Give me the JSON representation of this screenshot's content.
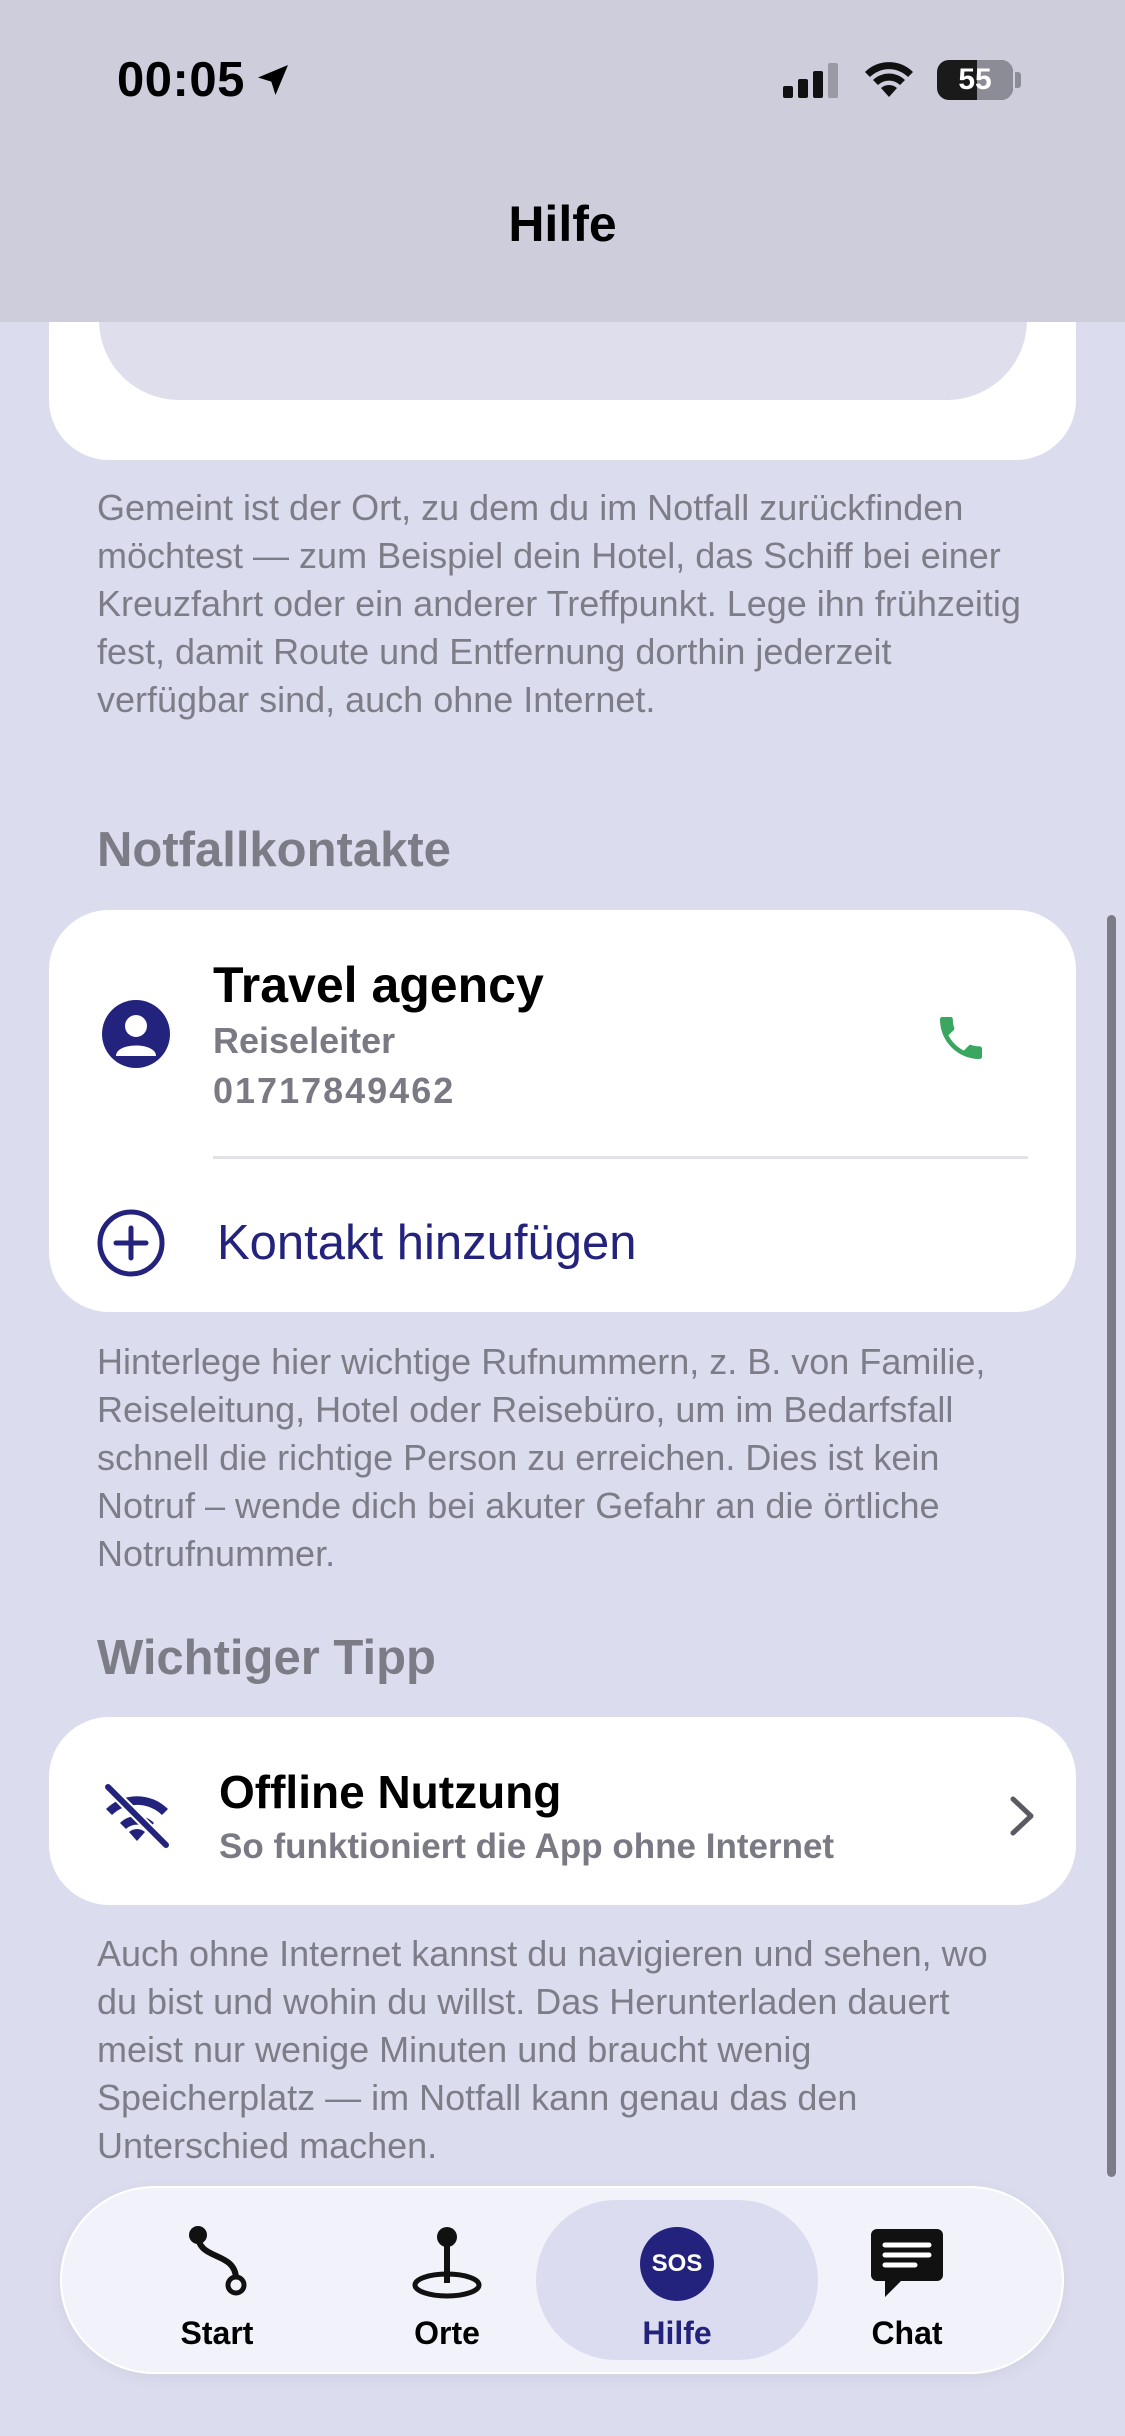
{
  "status_bar": {
    "time": "00:05",
    "battery": "55"
  },
  "nav": {
    "title": "Hilfe"
  },
  "meeting_point": {
    "description": "Gemeint ist der Ort, zu dem du im Notfall zurückfinden möchtest — zum Beispiel dein Hotel, das Schiff bei einer Kreuzfahrt oder ein anderer Treffpunkt. Lege ihn frühzeitig fest, damit Route und Entfernung dorthin jederzeit verfügbar sind, auch ohne Internet."
  },
  "emergency_contacts": {
    "title": "Notfallkontakte",
    "contacts": [
      {
        "name": "Travel agency",
        "role": "Reiseleiter",
        "phone": "01717849462"
      }
    ],
    "add_label": "Kontakt hinzufügen",
    "description": "Hinterlege hier wichtige Rufnummern, z. B. von Familie, Reiseleitung, Hotel oder Reisebüro, um im Bedarfsfall schnell die richtige Person zu erreichen. Dies ist kein Notruf – wende dich bei akuter Gefahr an die örtliche Notrufnummer."
  },
  "tip": {
    "title": "Wichtiger Tipp",
    "item_title": "Offline Nutzung",
    "item_subtitle": "So funktioniert die App ohne Internet",
    "description": "Auch ohne Internet kannst du navigieren und sehen, wo du bist und wohin du willst. Das Herunterladen dauert meist nur wenige Minuten und braucht wenig Speicherplatz — im Notfall kann genau das den Unterschied machen."
  },
  "tabbar": {
    "tabs": [
      {
        "label": "Start",
        "icon": "route-icon"
      },
      {
        "label": "Orte",
        "icon": "pin-icon"
      },
      {
        "label": "Hilfe",
        "icon": "sos-icon",
        "badge": "SOS",
        "selected": true
      },
      {
        "label": "Chat",
        "icon": "chat-icon"
      }
    ]
  },
  "colors": {
    "accent": "#23237e",
    "call_green": "#3aa660",
    "background": "#dcdcef"
  }
}
